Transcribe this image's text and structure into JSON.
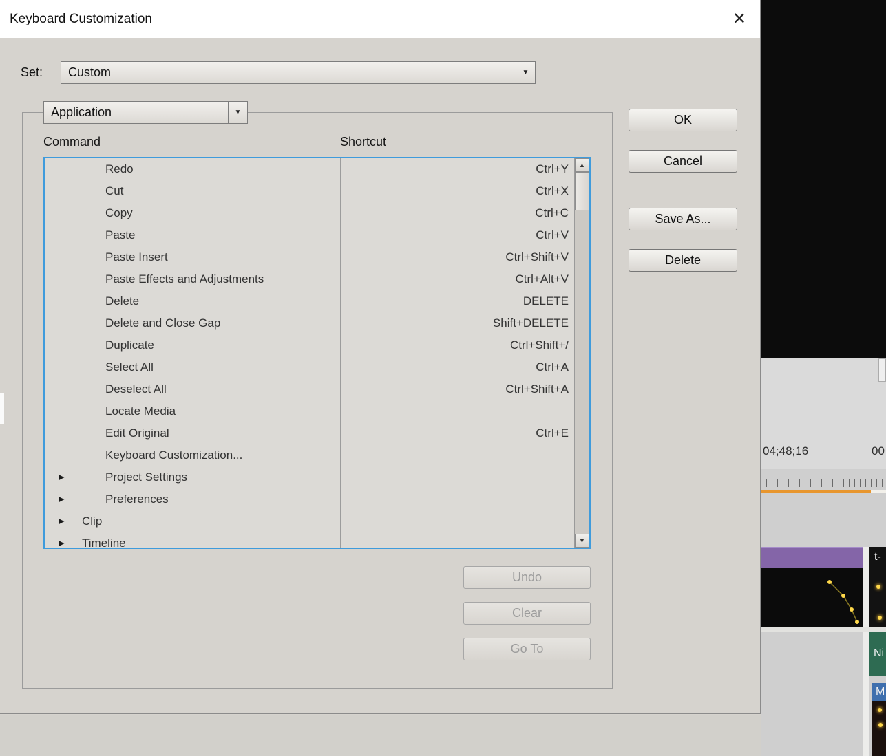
{
  "colors": {
    "accent": "#3f9bdc",
    "dialog-bg": "#d6d3ce",
    "row-bg": "#dcdad6",
    "row-border": "#9c9c9c",
    "purple-clip": "#8465a8",
    "orange-ruler": "#e8962e",
    "keyframe-yellow": "#ffd84a",
    "green-clip": "#2e6b52",
    "blue-clip": "#3e6fae"
  },
  "icons": {
    "close": "✕",
    "dropdown": "▼",
    "scroll_up": "▲",
    "scroll_down": "▼",
    "expander": "▶"
  },
  "dialog": {
    "title": "Keyboard Customization",
    "set_label": "Set:",
    "set_value": "Custom",
    "category_value": "Application",
    "columns": {
      "command": "Command",
      "shortcut": "Shortcut"
    },
    "rows": [
      {
        "label": "Redo",
        "shortcut": "Ctrl+Y",
        "indent": 2,
        "expander": false
      },
      {
        "label": "Cut",
        "shortcut": "Ctrl+X",
        "indent": 2,
        "expander": false
      },
      {
        "label": "Copy",
        "shortcut": "Ctrl+C",
        "indent": 2,
        "expander": false
      },
      {
        "label": "Paste",
        "shortcut": "Ctrl+V",
        "indent": 2,
        "expander": false
      },
      {
        "label": "Paste Insert",
        "shortcut": "Ctrl+Shift+V",
        "indent": 2,
        "expander": false
      },
      {
        "label": "Paste Effects and Adjustments",
        "shortcut": "Ctrl+Alt+V",
        "indent": 2,
        "expander": false
      },
      {
        "label": "Delete",
        "shortcut": "DELETE",
        "indent": 2,
        "expander": false
      },
      {
        "label": "Delete and Close Gap",
        "shortcut": "Shift+DELETE",
        "indent": 2,
        "expander": false
      },
      {
        "label": "Duplicate",
        "shortcut": "Ctrl+Shift+/",
        "indent": 2,
        "expander": false
      },
      {
        "label": "Select All",
        "shortcut": "Ctrl+A",
        "indent": 2,
        "expander": false
      },
      {
        "label": "Deselect All",
        "shortcut": "Ctrl+Shift+A",
        "indent": 2,
        "expander": false
      },
      {
        "label": "Locate Media",
        "shortcut": "",
        "indent": 2,
        "expander": false
      },
      {
        "label": "Edit Original",
        "shortcut": "Ctrl+E",
        "indent": 2,
        "expander": false
      },
      {
        "label": "Keyboard Customization...",
        "shortcut": "",
        "indent": 2,
        "expander": false
      },
      {
        "label": "Project Settings",
        "shortcut": "",
        "indent": 2,
        "expander": true
      },
      {
        "label": "Preferences",
        "shortcut": "",
        "indent": 2,
        "expander": true
      },
      {
        "label": "Clip",
        "shortcut": "",
        "indent": 1,
        "expander": true
      },
      {
        "label": "Timeline",
        "shortcut": "",
        "indent": 1,
        "expander": true
      }
    ],
    "side_buttons": {
      "ok": "OK",
      "cancel": "Cancel",
      "save_as": "Save As...",
      "delete": "Delete"
    },
    "bottom_buttons": {
      "undo": "Undo",
      "clear": "Clear",
      "go_to": "Go To"
    }
  },
  "timeline": {
    "timecode_left": "04;48;16",
    "timecode_right": "00",
    "clip_labels": {
      "t": "t-",
      "ni": "Ni",
      "m": "M"
    }
  }
}
